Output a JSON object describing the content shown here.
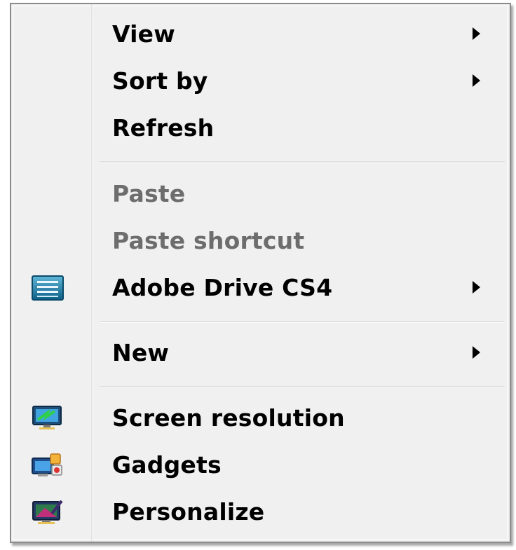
{
  "context_menu": {
    "items": [
      {
        "label": "View",
        "icon": null,
        "submenu": true,
        "disabled": false
      },
      {
        "label": "Sort by",
        "icon": null,
        "submenu": true,
        "disabled": false
      },
      {
        "label": "Refresh",
        "icon": null,
        "submenu": false,
        "disabled": false
      },
      {
        "label": "Paste",
        "icon": null,
        "submenu": false,
        "disabled": true
      },
      {
        "label": "Paste shortcut",
        "icon": null,
        "submenu": false,
        "disabled": true
      },
      {
        "label": "Adobe Drive CS4",
        "icon": "adobe-drive-icon",
        "submenu": true,
        "disabled": false
      },
      {
        "label": "New",
        "icon": null,
        "submenu": true,
        "disabled": false
      },
      {
        "label": "Screen resolution",
        "icon": "screen-resolution-icon",
        "submenu": false,
        "disabled": false
      },
      {
        "label": "Gadgets",
        "icon": "gadgets-icon",
        "submenu": false,
        "disabled": false
      },
      {
        "label": "Personalize",
        "icon": "personalize-icon",
        "submenu": false,
        "disabled": false
      }
    ]
  },
  "colors": {
    "menu_background": "#f0f0f0",
    "text": "#000000",
    "disabled_text": "#6d6d6d",
    "separator": "#e0e0e0"
  }
}
